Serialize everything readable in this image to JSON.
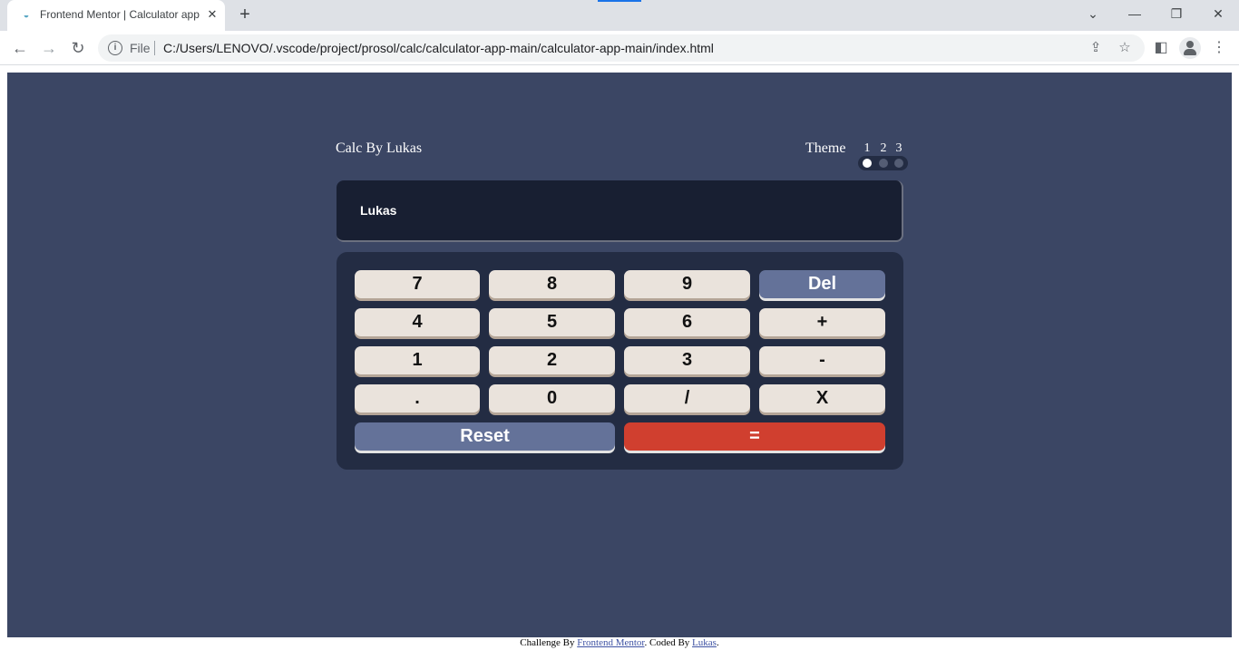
{
  "browser": {
    "tab_title": "Frontend Mentor | Calculator app",
    "url_scheme_label": "File",
    "url": "C:/Users/LENOVO/.vscode/project/prosol/calc/calculator-app-main/calculator-app-main/index.html",
    "icons": {
      "back": "arrow-left-icon",
      "forward": "arrow-right-icon",
      "reload": "reload-icon",
      "share": "share-icon",
      "star": "star-icon",
      "sidepanel": "side-panel-icon",
      "profile": "profile-icon",
      "menu": "kebab-menu-icon"
    }
  },
  "app": {
    "title": "Calc By Lukas",
    "theme_label": "Theme",
    "theme_options": [
      "1",
      "2",
      "3"
    ],
    "active_theme": 1,
    "display": "Lukas"
  },
  "keys": {
    "k7": "7",
    "k8": "8",
    "k9": "9",
    "del": "Del",
    "k4": "4",
    "k5": "5",
    "k6": "6",
    "plus": "+",
    "k1": "1",
    "k2": "2",
    "k3": "3",
    "minus": "-",
    "dot": ".",
    "k0": "0",
    "divide": "/",
    "multiply": "X",
    "reset": "Reset",
    "equals": "="
  },
  "footer": {
    "prefix": "Challenge By ",
    "link1": "Frontend Mentor",
    "middle": ". Coded By ",
    "link2": "Lukas",
    "suffix": "."
  },
  "colors": {
    "page_bg": "#3b4664",
    "keypad_bg": "#232c43",
    "screen_bg": "#181f32",
    "key_bg": "#eae3dc",
    "key_accent": "#647299",
    "key_equals": "#d03f2f"
  }
}
